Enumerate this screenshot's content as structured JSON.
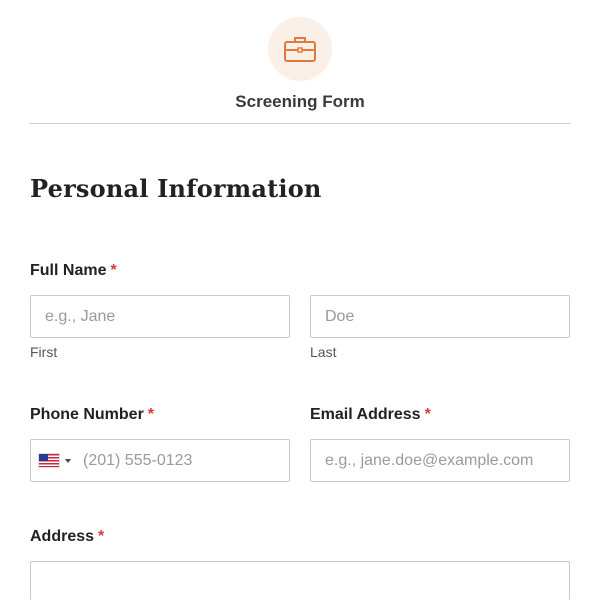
{
  "header": {
    "icon": "briefcase-icon",
    "title": "Screening Form",
    "accent_color": "#e07a3a"
  },
  "section": {
    "title": "Personal Information"
  },
  "fields": {
    "full_name": {
      "label": "Full Name",
      "required_mark": "*",
      "first": {
        "placeholder": "e.g., Jane",
        "sublabel": "First"
      },
      "last": {
        "placeholder": "Doe",
        "sublabel": "Last"
      }
    },
    "phone": {
      "label": "Phone Number",
      "required_mark": "*",
      "country_icon": "us-flag-icon",
      "placeholder": "(201) 555-0123"
    },
    "email": {
      "label": "Email Address",
      "required_mark": "*",
      "placeholder": "e.g., jane.doe@example.com"
    },
    "address": {
      "label": "Address",
      "required_mark": "*"
    }
  }
}
